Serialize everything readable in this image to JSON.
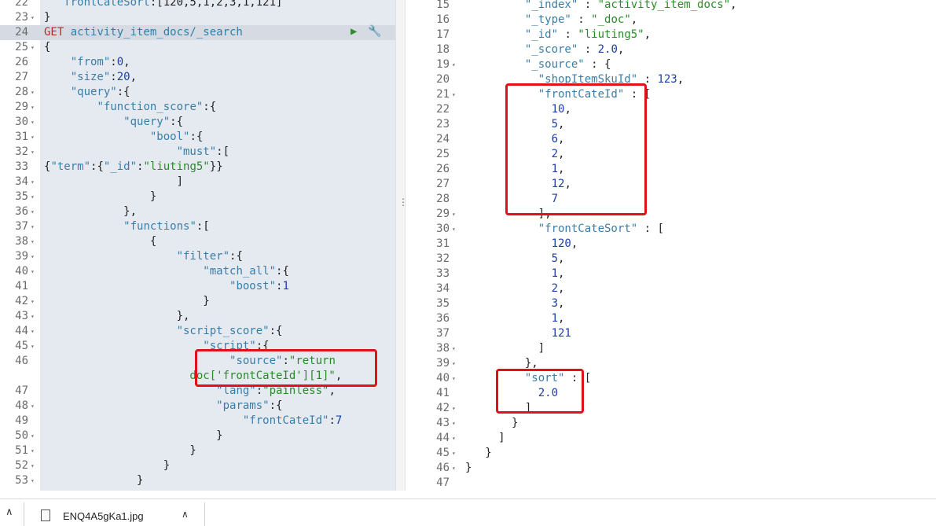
{
  "left": {
    "lines": [
      {
        "n": "22",
        "fold": false,
        "segs": [
          {
            "c": "k",
            "t": "   frontCateSort"
          },
          {
            "c": "",
            "t": ":[120,5,1,2,3,1,121]"
          }
        ]
      },
      {
        "n": "23",
        "fold": true,
        "segs": [
          {
            "c": "",
            "t": "}"
          }
        ]
      },
      {
        "n": "24",
        "fold": false,
        "active": true,
        "segs": [
          {
            "c": "req-method",
            "t": "GET "
          },
          {
            "c": "req-path",
            "t": "activity_item_docs/_search"
          }
        ]
      },
      {
        "n": "25",
        "fold": true,
        "segs": [
          {
            "c": "",
            "t": "{"
          }
        ]
      },
      {
        "n": "26",
        "fold": false,
        "segs": [
          {
            "c": "",
            "t": "    "
          },
          {
            "c": "k",
            "t": "\"from\""
          },
          {
            "c": "",
            "t": ":"
          },
          {
            "c": "n",
            "t": "0"
          },
          {
            "c": "",
            "t": ","
          }
        ]
      },
      {
        "n": "27",
        "fold": false,
        "segs": [
          {
            "c": "",
            "t": "    "
          },
          {
            "c": "k",
            "t": "\"size\""
          },
          {
            "c": "",
            "t": ":"
          },
          {
            "c": "n",
            "t": "20"
          },
          {
            "c": "",
            "t": ","
          }
        ]
      },
      {
        "n": "28",
        "fold": true,
        "segs": [
          {
            "c": "",
            "t": "    "
          },
          {
            "c": "k",
            "t": "\"query\""
          },
          {
            "c": "",
            "t": ":{"
          }
        ]
      },
      {
        "n": "29",
        "fold": true,
        "segs": [
          {
            "c": "",
            "t": "        "
          },
          {
            "c": "k",
            "t": "\"function_score\""
          },
          {
            "c": "",
            "t": ":{"
          }
        ]
      },
      {
        "n": "30",
        "fold": true,
        "segs": [
          {
            "c": "",
            "t": "            "
          },
          {
            "c": "k",
            "t": "\"query\""
          },
          {
            "c": "",
            "t": ":{"
          }
        ]
      },
      {
        "n": "31",
        "fold": true,
        "segs": [
          {
            "c": "",
            "t": "                "
          },
          {
            "c": "k",
            "t": "\"bool\""
          },
          {
            "c": "",
            "t": ":{"
          }
        ]
      },
      {
        "n": "32",
        "fold": true,
        "segs": [
          {
            "c": "",
            "t": "                    "
          },
          {
            "c": "k",
            "t": "\"must\""
          },
          {
            "c": "",
            "t": ":["
          }
        ]
      },
      {
        "n": "33",
        "fold": false,
        "segs": [
          {
            "c": "",
            "t": "{"
          },
          {
            "c": "k",
            "t": "\"term\""
          },
          {
            "c": "",
            "t": ":{"
          },
          {
            "c": "k",
            "t": "\"_id\""
          },
          {
            "c": "",
            "t": ":"
          },
          {
            "c": "s",
            "t": "\"liuting5\""
          },
          {
            "c": "",
            "t": "}}"
          }
        ]
      },
      {
        "n": "34",
        "fold": true,
        "segs": [
          {
            "c": "",
            "t": "                    ]"
          }
        ]
      },
      {
        "n": "35",
        "fold": true,
        "segs": [
          {
            "c": "",
            "t": "                }"
          }
        ]
      },
      {
        "n": "36",
        "fold": true,
        "segs": [
          {
            "c": "",
            "t": "            },"
          }
        ]
      },
      {
        "n": "37",
        "fold": true,
        "segs": [
          {
            "c": "",
            "t": "            "
          },
          {
            "c": "k",
            "t": "\"functions\""
          },
          {
            "c": "",
            "t": ":["
          }
        ]
      },
      {
        "n": "38",
        "fold": true,
        "segs": [
          {
            "c": "",
            "t": "                {"
          }
        ]
      },
      {
        "n": "39",
        "fold": true,
        "segs": [
          {
            "c": "",
            "t": "                    "
          },
          {
            "c": "k",
            "t": "\"filter\""
          },
          {
            "c": "",
            "t": ":{"
          }
        ]
      },
      {
        "n": "40",
        "fold": true,
        "segs": [
          {
            "c": "",
            "t": "                        "
          },
          {
            "c": "k",
            "t": "\"match_all\""
          },
          {
            "c": "",
            "t": ":{"
          }
        ]
      },
      {
        "n": "41",
        "fold": false,
        "segs": [
          {
            "c": "",
            "t": "                            "
          },
          {
            "c": "k",
            "t": "\"boost\""
          },
          {
            "c": "",
            "t": ":"
          },
          {
            "c": "n",
            "t": "1"
          }
        ]
      },
      {
        "n": "42",
        "fold": true,
        "segs": [
          {
            "c": "",
            "t": "                        }"
          }
        ]
      },
      {
        "n": "43",
        "fold": true,
        "segs": [
          {
            "c": "",
            "t": "                    },"
          }
        ]
      },
      {
        "n": "44",
        "fold": true,
        "segs": [
          {
            "c": "",
            "t": "                    "
          },
          {
            "c": "k",
            "t": "\"script_score\""
          },
          {
            "c": "",
            "t": ":{"
          }
        ]
      },
      {
        "n": "45",
        "fold": true,
        "segs": [
          {
            "c": "",
            "t": "                        "
          },
          {
            "c": "k",
            "t": "\"script\""
          },
          {
            "c": "",
            "t": ":{"
          }
        ]
      },
      {
        "n": "46",
        "fold": false,
        "segs": [
          {
            "c": "",
            "t": "                            "
          },
          {
            "c": "k",
            "t": "\"source\""
          },
          {
            "c": "",
            "t": ":"
          },
          {
            "c": "s",
            "t": "\"return"
          }
        ]
      },
      {
        "n": "",
        "fold": false,
        "segs": [
          {
            "c": "s",
            "t": "                      doc['frontCateId'][1]\""
          },
          {
            "c": "",
            "t": ","
          }
        ]
      },
      {
        "n": "47",
        "fold": false,
        "segs": [
          {
            "c": "",
            "t": "                          "
          },
          {
            "c": "k",
            "t": "\"lang\""
          },
          {
            "c": "",
            "t": ":"
          },
          {
            "c": "s",
            "t": "\"painless\""
          },
          {
            "c": "",
            "t": ","
          }
        ]
      },
      {
        "n": "48",
        "fold": true,
        "segs": [
          {
            "c": "",
            "t": "                          "
          },
          {
            "c": "k",
            "t": "\"params\""
          },
          {
            "c": "",
            "t": ":{"
          }
        ]
      },
      {
        "n": "49",
        "fold": false,
        "segs": [
          {
            "c": "",
            "t": "                              "
          },
          {
            "c": "k",
            "t": "\"frontCateId\""
          },
          {
            "c": "",
            "t": ":"
          },
          {
            "c": "n",
            "t": "7"
          }
        ]
      },
      {
        "n": "50",
        "fold": true,
        "segs": [
          {
            "c": "",
            "t": "                          }"
          }
        ]
      },
      {
        "n": "51",
        "fold": true,
        "segs": [
          {
            "c": "",
            "t": "                      }"
          }
        ]
      },
      {
        "n": "52",
        "fold": true,
        "segs": [
          {
            "c": "",
            "t": "                  }"
          }
        ]
      },
      {
        "n": "53",
        "fold": true,
        "segs": [
          {
            "c": "",
            "t": "              }"
          }
        ]
      }
    ]
  },
  "right": {
    "lines": [
      {
        "n": "15",
        "fold": false,
        "segs": [
          {
            "c": "",
            "t": "         "
          },
          {
            "c": "k",
            "t": "\"_index\""
          },
          {
            "c": "",
            "t": " : "
          },
          {
            "c": "s",
            "t": "\"activity_item_docs\""
          },
          {
            "c": "",
            "t": ","
          }
        ]
      },
      {
        "n": "16",
        "fold": false,
        "segs": [
          {
            "c": "",
            "t": "         "
          },
          {
            "c": "k",
            "t": "\"_type\""
          },
          {
            "c": "",
            "t": " : "
          },
          {
            "c": "s",
            "t": "\"_doc\""
          },
          {
            "c": "",
            "t": ","
          }
        ]
      },
      {
        "n": "17",
        "fold": false,
        "segs": [
          {
            "c": "",
            "t": "         "
          },
          {
            "c": "k",
            "t": "\"_id\""
          },
          {
            "c": "",
            "t": " : "
          },
          {
            "c": "s",
            "t": "\"liuting5\""
          },
          {
            "c": "",
            "t": ","
          }
        ]
      },
      {
        "n": "18",
        "fold": false,
        "segs": [
          {
            "c": "",
            "t": "         "
          },
          {
            "c": "k",
            "t": "\"_score\""
          },
          {
            "c": "",
            "t": " : "
          },
          {
            "c": "n",
            "t": "2.0"
          },
          {
            "c": "",
            "t": ","
          }
        ]
      },
      {
        "n": "19",
        "fold": true,
        "segs": [
          {
            "c": "",
            "t": "         "
          },
          {
            "c": "k",
            "t": "\"_source\""
          },
          {
            "c": "",
            "t": " : {"
          }
        ]
      },
      {
        "n": "20",
        "fold": false,
        "segs": [
          {
            "c": "",
            "t": "           "
          },
          {
            "c": "k",
            "t": "\"shopItemSkuId\""
          },
          {
            "c": "",
            "t": " : "
          },
          {
            "c": "n",
            "t": "123"
          },
          {
            "c": "",
            "t": ","
          }
        ]
      },
      {
        "n": "21",
        "fold": true,
        "segs": [
          {
            "c": "",
            "t": "           "
          },
          {
            "c": "k",
            "t": "\"frontCateId\""
          },
          {
            "c": "",
            "t": " : ["
          }
        ]
      },
      {
        "n": "22",
        "fold": false,
        "segs": [
          {
            "c": "",
            "t": "             "
          },
          {
            "c": "n",
            "t": "10"
          },
          {
            "c": "",
            "t": ","
          }
        ]
      },
      {
        "n": "23",
        "fold": false,
        "segs": [
          {
            "c": "",
            "t": "             "
          },
          {
            "c": "n",
            "t": "5"
          },
          {
            "c": "",
            "t": ","
          }
        ]
      },
      {
        "n": "24",
        "fold": false,
        "segs": [
          {
            "c": "",
            "t": "             "
          },
          {
            "c": "n",
            "t": "6"
          },
          {
            "c": "",
            "t": ","
          }
        ]
      },
      {
        "n": "25",
        "fold": false,
        "segs": [
          {
            "c": "",
            "t": "             "
          },
          {
            "c": "n",
            "t": "2"
          },
          {
            "c": "",
            "t": ","
          }
        ]
      },
      {
        "n": "26",
        "fold": false,
        "segs": [
          {
            "c": "",
            "t": "             "
          },
          {
            "c": "n",
            "t": "1"
          },
          {
            "c": "",
            "t": ","
          }
        ]
      },
      {
        "n": "27",
        "fold": false,
        "segs": [
          {
            "c": "",
            "t": "             "
          },
          {
            "c": "n",
            "t": "12"
          },
          {
            "c": "",
            "t": ","
          }
        ]
      },
      {
        "n": "28",
        "fold": false,
        "segs": [
          {
            "c": "",
            "t": "             "
          },
          {
            "c": "n",
            "t": "7"
          }
        ]
      },
      {
        "n": "29",
        "fold": true,
        "segs": [
          {
            "c": "",
            "t": "           ],"
          }
        ]
      },
      {
        "n": "30",
        "fold": true,
        "segs": [
          {
            "c": "",
            "t": "           "
          },
          {
            "c": "k",
            "t": "\"frontCateSort\""
          },
          {
            "c": "",
            "t": " : ["
          }
        ]
      },
      {
        "n": "31",
        "fold": false,
        "segs": [
          {
            "c": "",
            "t": "             "
          },
          {
            "c": "n",
            "t": "120"
          },
          {
            "c": "",
            "t": ","
          }
        ]
      },
      {
        "n": "32",
        "fold": false,
        "segs": [
          {
            "c": "",
            "t": "             "
          },
          {
            "c": "n",
            "t": "5"
          },
          {
            "c": "",
            "t": ","
          }
        ]
      },
      {
        "n": "33",
        "fold": false,
        "segs": [
          {
            "c": "",
            "t": "             "
          },
          {
            "c": "n",
            "t": "1"
          },
          {
            "c": "",
            "t": ","
          }
        ]
      },
      {
        "n": "34",
        "fold": false,
        "segs": [
          {
            "c": "",
            "t": "             "
          },
          {
            "c": "n",
            "t": "2"
          },
          {
            "c": "",
            "t": ","
          }
        ]
      },
      {
        "n": "35",
        "fold": false,
        "segs": [
          {
            "c": "",
            "t": "             "
          },
          {
            "c": "n",
            "t": "3"
          },
          {
            "c": "",
            "t": ","
          }
        ]
      },
      {
        "n": "36",
        "fold": false,
        "segs": [
          {
            "c": "",
            "t": "             "
          },
          {
            "c": "n",
            "t": "1"
          },
          {
            "c": "",
            "t": ","
          }
        ]
      },
      {
        "n": "37",
        "fold": false,
        "segs": [
          {
            "c": "",
            "t": "             "
          },
          {
            "c": "n",
            "t": "121"
          }
        ]
      },
      {
        "n": "38",
        "fold": true,
        "segs": [
          {
            "c": "",
            "t": "           ]"
          }
        ]
      },
      {
        "n": "39",
        "fold": true,
        "segs": [
          {
            "c": "",
            "t": "         },"
          }
        ]
      },
      {
        "n": "40",
        "fold": true,
        "segs": [
          {
            "c": "",
            "t": "         "
          },
          {
            "c": "k",
            "t": "\"sort\""
          },
          {
            "c": "",
            "t": " : ["
          }
        ]
      },
      {
        "n": "41",
        "fold": false,
        "segs": [
          {
            "c": "",
            "t": "           "
          },
          {
            "c": "n",
            "t": "2.0"
          }
        ]
      },
      {
        "n": "42",
        "fold": true,
        "segs": [
          {
            "c": "",
            "t": "         ]"
          }
        ]
      },
      {
        "n": "43",
        "fold": true,
        "segs": [
          {
            "c": "",
            "t": "       }"
          }
        ]
      },
      {
        "n": "44",
        "fold": true,
        "segs": [
          {
            "c": "",
            "t": "     ]"
          }
        ]
      },
      {
        "n": "45",
        "fold": true,
        "segs": [
          {
            "c": "",
            "t": "   }"
          }
        ]
      },
      {
        "n": "46",
        "fold": true,
        "segs": [
          {
            "c": "",
            "t": "}"
          }
        ]
      },
      {
        "n": "47",
        "fold": false,
        "segs": []
      }
    ]
  },
  "toolbar": {
    "run_icon": "play-icon",
    "settings_icon": "wrench-icon"
  },
  "splitter": {
    "glyph": "⋮"
  },
  "downloads": {
    "file_name": "ENQ4A5gKa1.jpg",
    "left_glyph": "∧",
    "chevron_glyph": "∧"
  },
  "colors": {
    "highlight": "#e0111b",
    "request_bg": "#e5e9f0",
    "active_line": "#d5dae3"
  }
}
